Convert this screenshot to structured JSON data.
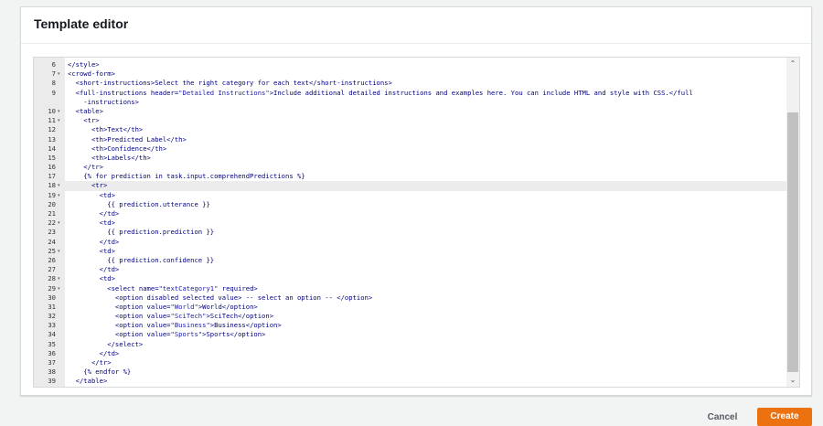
{
  "panel": {
    "title": "Template editor"
  },
  "editor": {
    "active_line": "18",
    "lines": [
      {
        "n": "6",
        "fold": "",
        "text": "</style>"
      },
      {
        "n": "7",
        "fold": "▾",
        "text": "<crowd-form>"
      },
      {
        "n": "8",
        "fold": "",
        "text": "  <short-instructions>Select the right category for each text</short-instructions>"
      },
      {
        "n": "9",
        "fold": "",
        "text": "  <full-instructions header=\"Detailed Instructions\">Include additional detailed instructions and examples here. You can include HTML and style with CSS.</full"
      },
      {
        "n": "",
        "fold": "",
        "text": "    -instructions>"
      },
      {
        "n": "10",
        "fold": "▾",
        "text": "  <table>"
      },
      {
        "n": "11",
        "fold": "▾",
        "text": "    <tr>"
      },
      {
        "n": "12",
        "fold": "",
        "text": "      <th>Text</th>"
      },
      {
        "n": "13",
        "fold": "",
        "text": "      <th>Predicted Label</th>"
      },
      {
        "n": "14",
        "fold": "",
        "text": "      <th>Confidence</th>"
      },
      {
        "n": "15",
        "fold": "",
        "text": "      <th>Labels</th>"
      },
      {
        "n": "16",
        "fold": "",
        "text": "    </tr>"
      },
      {
        "n": "17",
        "fold": "",
        "text": "    {% for prediction in task.input.comprehendPredictions %}"
      },
      {
        "n": "18",
        "fold": "▾",
        "text": "      <tr>"
      },
      {
        "n": "19",
        "fold": "▾",
        "text": "        <td>"
      },
      {
        "n": "20",
        "fold": "",
        "text": "          {{ prediction.utterance }}"
      },
      {
        "n": "21",
        "fold": "",
        "text": "        </td>"
      },
      {
        "n": "22",
        "fold": "▾",
        "text": "        <td>"
      },
      {
        "n": "23",
        "fold": "",
        "text": "          {{ prediction.prediction }}"
      },
      {
        "n": "24",
        "fold": "",
        "text": "        </td>"
      },
      {
        "n": "25",
        "fold": "▾",
        "text": "        <td>"
      },
      {
        "n": "26",
        "fold": "",
        "text": "          {{ prediction.confidence }}"
      },
      {
        "n": "27",
        "fold": "",
        "text": "        </td>"
      },
      {
        "n": "28",
        "fold": "▾",
        "text": "        <td>"
      },
      {
        "n": "29",
        "fold": "▾",
        "text": "          <select name=\"textCategory1\" required>"
      },
      {
        "n": "30",
        "fold": "",
        "text": "            <option disabled selected value> -- select an option -- </option>"
      },
      {
        "n": "31",
        "fold": "",
        "text": "            <option value=\"World\">World</option>"
      },
      {
        "n": "32",
        "fold": "",
        "text": "            <option value=\"SciTech\">SciTech</option>"
      },
      {
        "n": "33",
        "fold": "",
        "text": "            <option value=\"Business\">Business</option>"
      },
      {
        "n": "34",
        "fold": "",
        "text": "            <option value=\"Sports\">Sports</option>"
      },
      {
        "n": "35",
        "fold": "",
        "text": "          </select>"
      },
      {
        "n": "36",
        "fold": "",
        "text": "        </td>"
      },
      {
        "n": "37",
        "fold": "",
        "text": "      </tr>"
      },
      {
        "n": "38",
        "fold": "",
        "text": "    {% endfor %}"
      },
      {
        "n": "39",
        "fold": "",
        "text": "  </table>"
      }
    ]
  },
  "scrollbar": {
    "up_icon": "chevron-up-icon",
    "down_icon": "chevron-down-icon"
  },
  "footer": {
    "cancel_label": "Cancel",
    "create_label": "Create"
  },
  "colors": {
    "primary": "#ec7211",
    "tag": "#000080",
    "string": "#1a1aa6"
  }
}
